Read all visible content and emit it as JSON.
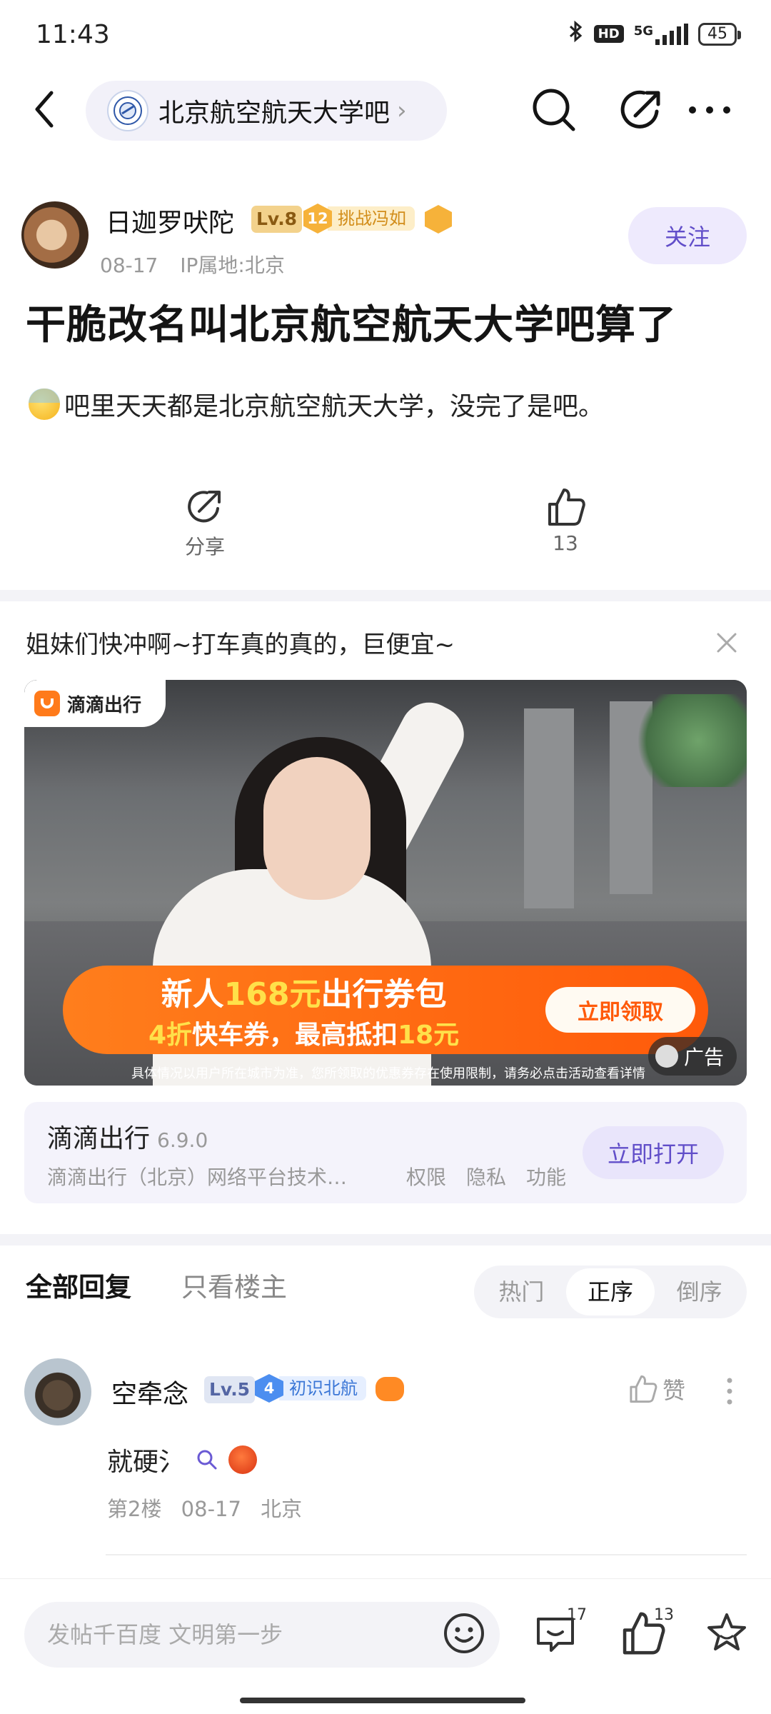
{
  "status_bar": {
    "time": "11:43",
    "network": "5G",
    "hd": "HD",
    "battery": "45"
  },
  "header": {
    "forum_name": "北京航空航天大学吧",
    "chevron": "›"
  },
  "post": {
    "author": "日迦罗吠陀",
    "level": "Lv.8",
    "medal_number": "12",
    "medal_title": "挑战冯如",
    "date": "08-17",
    "ip": "IP属地:北京",
    "follow_label": "关注",
    "title": "干脆改名叫北京航空航天大学吧算了",
    "body": "吧里天天都是北京航空航天大学，没完了是吧。",
    "share_label": "分享",
    "like_count": "13"
  },
  "ad": {
    "title": "姐妹们快冲啊~打车真的真的，巨便宜~",
    "brand": "滴滴出行",
    "banner_line1_prefix": "新人",
    "banner_line1_highlight": "168元",
    "banner_line1_suffix": "出行券包",
    "banner_line2_prefix": "4折",
    "banner_line2_mid": "快车券，最高抵扣",
    "banner_line2_highlight": "18元",
    "banner_button": "立即领取",
    "disclaimer": "具体情况以用户所在城市为准，您所领取的优惠券存在使用限制，请务必点击活动查看详情",
    "ad_label": "广告",
    "app_name": "滴滴出行",
    "app_version": "6.9.0",
    "app_corp": "滴滴出行（北京）网络平台技术…",
    "app_links": [
      "权限",
      "隐私",
      "功能"
    ],
    "open_label": "立即打开"
  },
  "replies_header": {
    "tab_all": "全部回复",
    "tab_op": "只看楼主",
    "sort_options": [
      "热门",
      "正序",
      "倒序"
    ],
    "active_sort": "正序"
  },
  "reply": {
    "author": "空牵念",
    "level": "Lv.5",
    "medal_number": "4",
    "medal_title": "初识北航",
    "like_label": "赞",
    "text": "就硬氵",
    "floor": "第2楼",
    "date": "08-17",
    "location": "北京"
  },
  "bottom_bar": {
    "placeholder": "发帖千百度 文明第一步",
    "comment_count": "17",
    "like_count": "13"
  },
  "colors": {
    "accent": "#614ec9",
    "accent_bg": "#eeeafd",
    "didi_orange": "#ff6a12"
  }
}
